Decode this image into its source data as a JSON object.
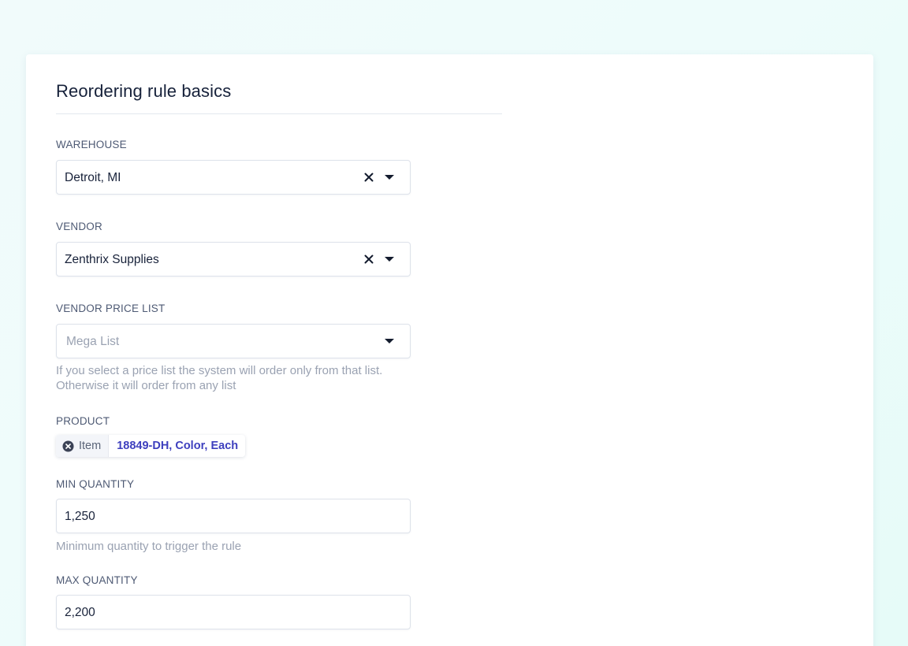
{
  "section": {
    "title": "Reordering rule basics"
  },
  "warehouse": {
    "label": "WAREHOUSE",
    "value": "Detroit, MI"
  },
  "vendor": {
    "label": "VENDOR",
    "value": "Zenthrix Supplies"
  },
  "vendor_price_list": {
    "label": "VENDOR PRICE LIST",
    "placeholder": "Mega List",
    "help_line1": "If you select a price list the system will order only from that list.",
    "help_line2": "Otherwise it will order from any list"
  },
  "product": {
    "label": "PRODUCT",
    "chip_type": "Item",
    "chip_value": "18849-DH, Color, Each"
  },
  "min_quantity": {
    "label": "MIN QUANTITY",
    "value": "1,250",
    "help": "Minimum quantity to trigger the rule"
  },
  "max_quantity": {
    "label": "MAX QUANTITY",
    "value": "2,200"
  },
  "icons": {
    "clear": "close-icon",
    "caret": "chevron-down-icon",
    "chip_remove": "close-circle-icon"
  },
  "colors": {
    "accent": "#3d3fbe",
    "muted_text": "#9aa2b2",
    "label_text": "#4e5a74"
  }
}
